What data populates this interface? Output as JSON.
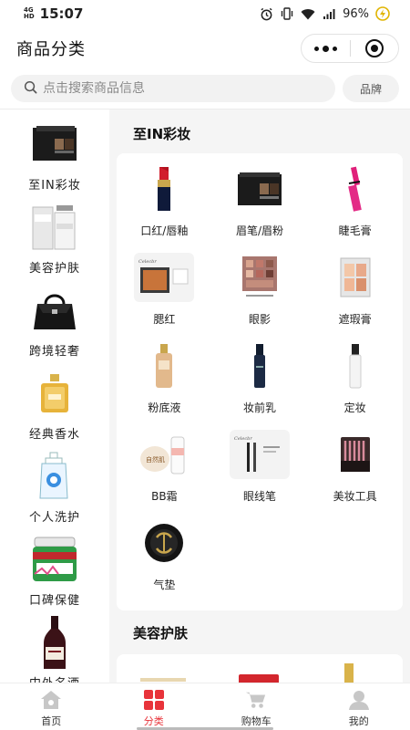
{
  "status_bar": {
    "network": "4G",
    "network2": "HD",
    "time": "15:07",
    "battery": "96%"
  },
  "header": {
    "title": "商品分类"
  },
  "search": {
    "placeholder": "点击搜索商品信息",
    "brand_label": "品牌"
  },
  "sidebar": {
    "items": [
      {
        "label": "至IN彩妆",
        "icon": "eyeshadow-palette-thumb"
      },
      {
        "label": "美容护肤",
        "icon": "skincare-bottle-thumb"
      },
      {
        "label": "跨境轻奢",
        "icon": "handbag-thumb"
      },
      {
        "label": "经典香水",
        "icon": "perfume-thumb"
      },
      {
        "label": "个人洗护",
        "icon": "body-wash-thumb"
      },
      {
        "label": "口碑保健",
        "icon": "supplement-jar-thumb"
      },
      {
        "label": "中外名酒",
        "icon": "wine-bottle-thumb"
      }
    ]
  },
  "main": {
    "section1_title": "至IN彩妆",
    "categories": [
      {
        "name": "口红/唇釉",
        "icon": "lipstick-icon"
      },
      {
        "name": "眉笔/眉粉",
        "icon": "brow-palette-icon"
      },
      {
        "name": "睫毛膏",
        "icon": "mascara-icon"
      },
      {
        "name": "腮红",
        "icon": "blush-icon"
      },
      {
        "name": "眼影",
        "icon": "eyeshadow-icon"
      },
      {
        "name": "遮瑕膏",
        "icon": "concealer-icon"
      },
      {
        "name": "粉底液",
        "icon": "foundation-icon"
      },
      {
        "name": "妆前乳",
        "icon": "primer-icon"
      },
      {
        "name": "定妆",
        "icon": "setting-spray-icon"
      },
      {
        "name": "BB霜",
        "icon": "bb-cream-icon"
      },
      {
        "name": "眼线笔",
        "icon": "eyeliner-icon"
      },
      {
        "name": "美妆工具",
        "icon": "brush-set-icon"
      },
      {
        "name": "气垫",
        "icon": "cushion-icon"
      }
    ],
    "section2_title": "美容护肤",
    "logo_text": "Celecbr"
  },
  "tabbar": {
    "tabs": [
      {
        "label": "首页",
        "icon": "home-icon"
      },
      {
        "label": "分类",
        "icon": "category-icon"
      },
      {
        "label": "购物车",
        "icon": "cart-icon"
      },
      {
        "label": "我的",
        "icon": "profile-icon"
      }
    ],
    "active_color": "#e8333a"
  }
}
